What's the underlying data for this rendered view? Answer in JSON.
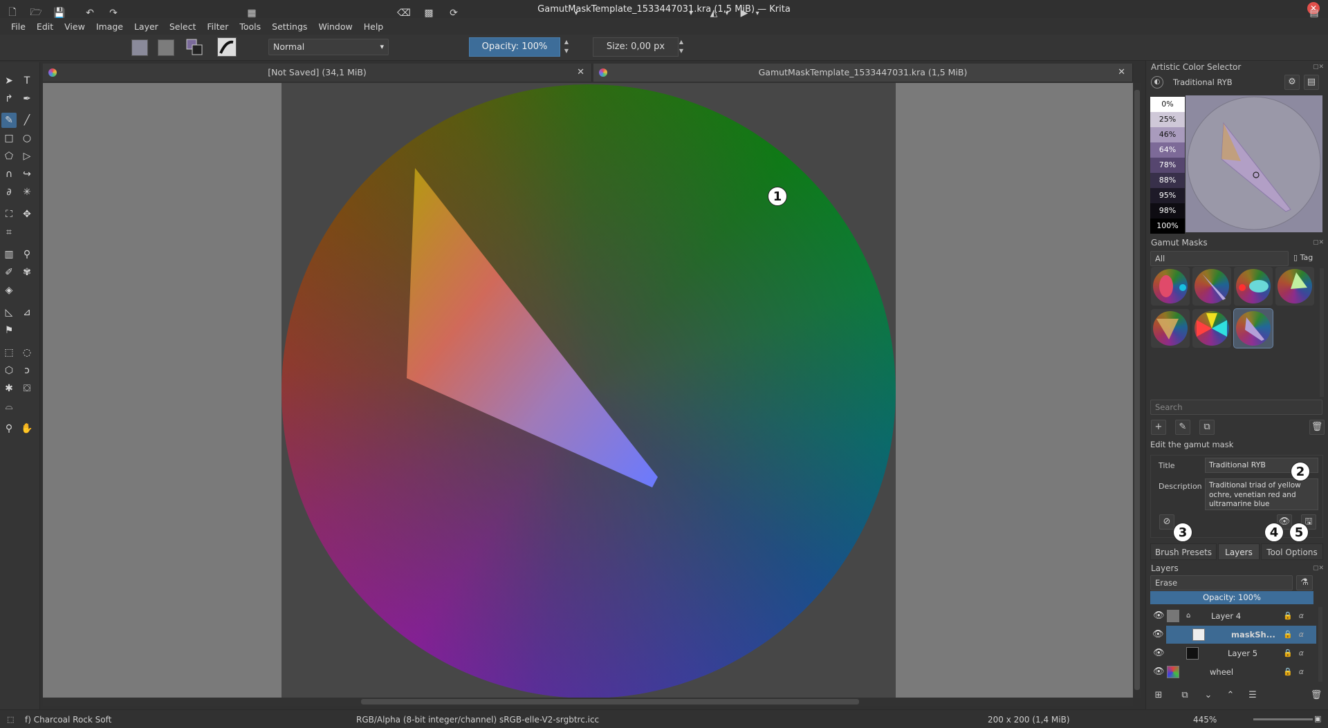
{
  "window": {
    "title": "GamutMaskTemplate_1533447031.kra (1,5 MiB)  — Krita"
  },
  "menu": [
    "File",
    "Edit",
    "View",
    "Image",
    "Layer",
    "Select",
    "Filter",
    "Tools",
    "Settings",
    "Window",
    "Help"
  ],
  "toolbar": {
    "blend_mode": "Normal",
    "opacity_label": "Opacity:  100%",
    "size_label": "Size:  0,00 px"
  },
  "documents": [
    {
      "title": "[Not Saved]  (34,1 MiB)"
    },
    {
      "title": "GamutMaskTemplate_1533447031.kra (1,5 MiB)"
    }
  ],
  "callouts": [
    "1",
    "2",
    "3",
    "4",
    "5"
  ],
  "artistic_color_selector": {
    "title": "Artistic Color Selector",
    "mask_name": "Traditional RYB",
    "value_steps": [
      "0%",
      "25%",
      "46%",
      "64%",
      "78%",
      "88%",
      "95%",
      "98%",
      "100%"
    ]
  },
  "gamut_masks": {
    "title": "Gamut Masks",
    "filter": "All",
    "tag_label": "Tag",
    "search_placeholder": "Search",
    "edit_header": "Edit the gamut mask",
    "title_label": "Title",
    "title_value": "Traditional RYB",
    "description_label": "Description",
    "description_value": "Traditional triad of yellow ochre, venetian red and ultramarine blue"
  },
  "dock_tabs": [
    "Brush Presets",
    "Layers",
    "Tool Options"
  ],
  "layers": {
    "title": "Layers",
    "blend_mode": "Erase",
    "opacity_label": "Opacity:  100%",
    "items": [
      {
        "name": "Layer 4"
      },
      {
        "name": "maskSh..."
      },
      {
        "name": "Layer 5"
      },
      {
        "name": "wheel"
      }
    ]
  },
  "status": {
    "brush": "f) Charcoal Rock Soft",
    "color_space": "RGB/Alpha (8-bit integer/channel)  sRGB-elle-V2-srgbtrc.icc",
    "image_size": "200 x 200 (1,4 MiB)",
    "zoom": "445%"
  },
  "colors": {
    "accent": "#3d6d99",
    "selection": "#3d6a93"
  }
}
